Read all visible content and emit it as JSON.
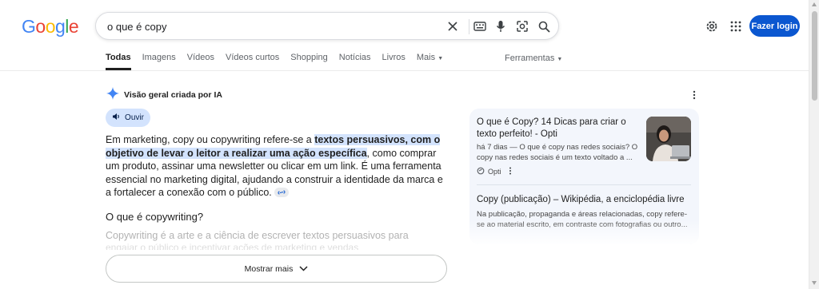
{
  "brand": {
    "logo_letters": [
      "G",
      "o",
      "o",
      "g",
      "l",
      "e"
    ],
    "logo_colors": [
      "#4285f4",
      "#ea4335",
      "#fbbc05",
      "#4285f4",
      "#34a853",
      "#ea4335"
    ]
  },
  "search": {
    "query": "o que é copy",
    "icons": [
      "close-icon",
      "keyboard-icon",
      "mic-icon",
      "lens-icon",
      "search-icon"
    ]
  },
  "header": {
    "login_label": "Fazer login",
    "icons": [
      "gear-icon",
      "apps-icon"
    ]
  },
  "tabs": [
    {
      "label": "Todas",
      "active": true
    },
    {
      "label": "Imagens",
      "active": false
    },
    {
      "label": "Vídeos",
      "active": false
    },
    {
      "label": "Vídeos curtos",
      "active": false
    },
    {
      "label": "Shopping",
      "active": false
    },
    {
      "label": "Notícias",
      "active": false
    },
    {
      "label": "Livros",
      "active": false
    },
    {
      "label": "Mais",
      "active": false
    }
  ],
  "tools_label": "Ferramentas",
  "ai_overview": {
    "header": "Visão geral criada por IA",
    "listen_label": "Ouvir",
    "text_before": "Em marketing, copy ou copywriting refere-se a ",
    "text_highlight": "textos persuasivos, com o objetivo de levar o leitor a realizar uma ação específica",
    "text_after": ", como comprar um produto, assinar uma newsletter ou clicar em um link. É uma ferramenta essencial no marketing digital, ajudando a construir a identidade da marca e a fortalecer a conexão com o público.",
    "subheading": "O que é copywriting?",
    "faded_line1": "Copywriting é a arte e a ciência de escrever textos persuasivos para",
    "faded_line2": "engajar o público e incentivar ações de marketing e vendas",
    "show_more_label": "Mostrar mais",
    "accent_color": "#0b57d0"
  },
  "sources": [
    {
      "title": "O que é Copy? 14 Dicas para criar o texto perfeito! - Opti",
      "snippet": "há 7 dias — O que é copy nas redes sociais? O copy nas redes sociais é um texto voltado a ...",
      "site": "Opti"
    },
    {
      "title": "Copy (publicação) – Wikipédia, a enciclopédia livre",
      "snippet": "Na publicação, propaganda e áreas relacionadas, copy refere-se ao material escrito, em contraste com fotografias ou outro..."
    }
  ]
}
